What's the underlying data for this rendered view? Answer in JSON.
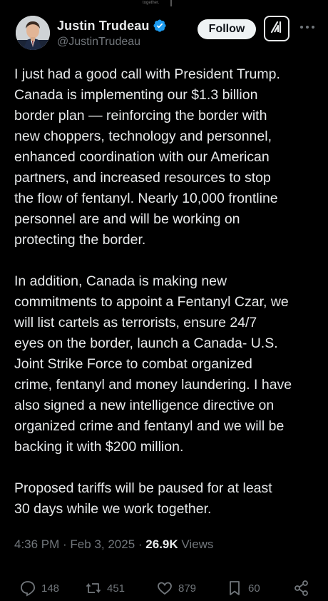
{
  "top_fragment": "together.",
  "author": {
    "display_name": "Justin Trudeau",
    "handle": "@JustinTrudeau",
    "verified": true
  },
  "header_buttons": {
    "follow_label": "Follow"
  },
  "icons": {
    "avatar": "avatar-photo",
    "verified": "verified-badge-icon",
    "grok": "grok-icon",
    "more": "more-dots-icon",
    "reply": "reply-icon",
    "repost": "repost-icon",
    "like": "like-icon",
    "bookmark": "bookmark-icon",
    "share": "share-icon"
  },
  "tweet": {
    "paragraphs": [
      "I just had a good call with President Trump.\nCanada is implementing our $1.3 billion\nborder plan — reinforcing the border with\nnew choppers, technology and personnel,\nenhanced coordination with our American\npartners, and increased resources to stop\nthe flow of fentanyl. Nearly 10,000 frontline\npersonnel are and will be working on\nprotecting the border.",
      "In addition, Canada is making new\ncommitments to appoint a Fentanyl Czar, we\nwill list cartels as terrorists, ensure 24/7\neyes on the border, launch a Canada- U.S.\nJoint Strike Force to combat organized\ncrime, fentanyl and money laundering. I have\nalso signed a new intelligence directive on\norganized crime and fentanyl and we will be\nbacking it with $200 million.",
      "Proposed tariffs will be paused for at least\n30 days while we work together."
    ]
  },
  "meta": {
    "time": "4:36 PM",
    "separator": " · ",
    "date": "Feb 3, 2025",
    "views_count": "26.9K",
    "views_label": " Views"
  },
  "actions": {
    "replies": "148",
    "reposts": "451",
    "likes": "879",
    "bookmarks": "60"
  },
  "colors": {
    "background": "#000000",
    "text_primary": "#e7e9ea",
    "text_secondary": "#71767b",
    "verified_badge": "#1d9bf0",
    "follow_button_bg": "#eff3f4"
  }
}
